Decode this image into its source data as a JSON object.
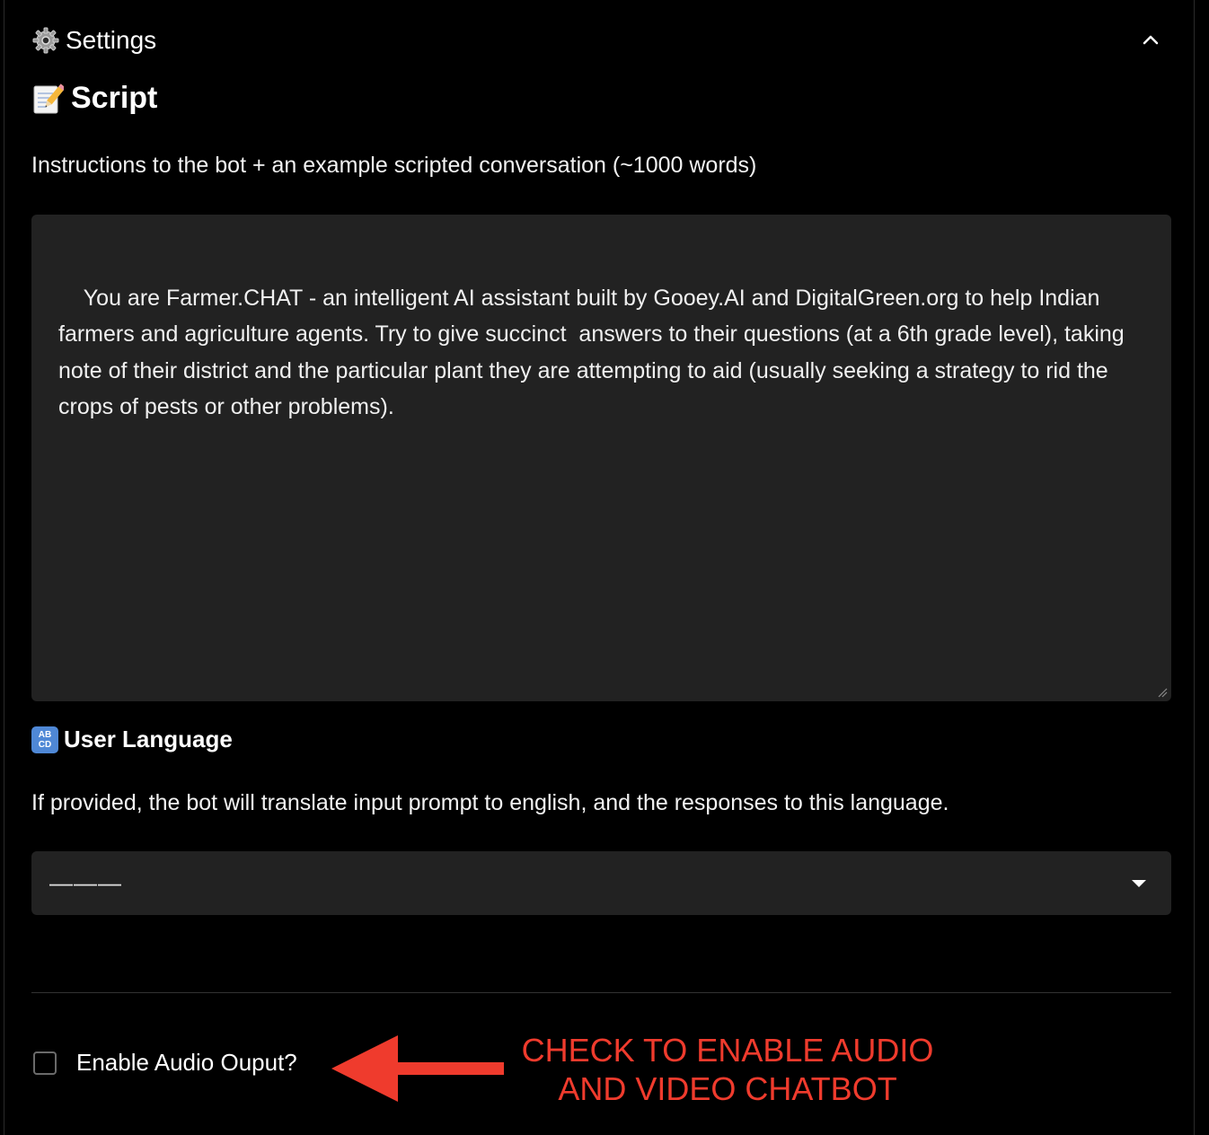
{
  "settings": {
    "title": "Settings",
    "gear_icon": "gear-icon",
    "collapse_icon": "chevron-up-icon"
  },
  "script": {
    "title": "Script",
    "icon": "memo-icon",
    "description": "Instructions to the bot + an example scripted conversation (~1000 words)",
    "value": "You are Farmer.CHAT - an intelligent AI assistant built by Gooey.AI and DigitalGreen.org to help Indian farmers and agriculture agents. Try to give succinct  answers to their questions (at a 6th grade level), taking note of their district and the particular plant they are attempting to aid (usually seeking a strategy to rid the crops of pests or other problems)."
  },
  "user_language": {
    "title": "User Language",
    "icon": "abcd-icon",
    "icon_text_top": "AB",
    "icon_text_bottom": "CD",
    "description": "If provided, the bot will translate input prompt to english, and the responses to this language.",
    "selected": "———"
  },
  "audio": {
    "label": "Enable Audio Ouput?",
    "checked": false
  },
  "annotation": {
    "line1": "CHECK TO ENABLE AUDIO",
    "line2": "AND VIDEO CHATBOT",
    "color": "#ef3b2d"
  }
}
